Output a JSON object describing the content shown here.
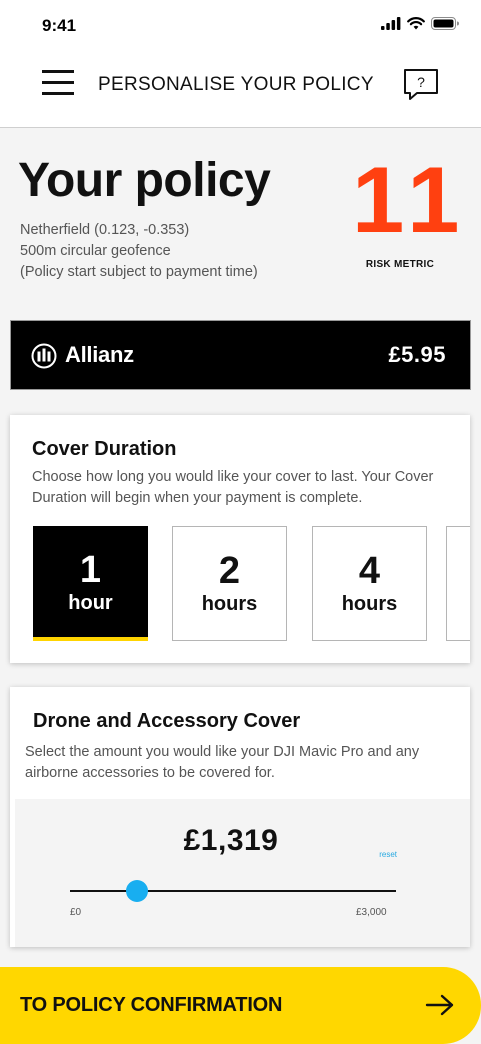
{
  "status_bar": {
    "time": "9:41"
  },
  "header": {
    "title": "PERSONALISE YOUR POLICY"
  },
  "policy": {
    "title": "Your policy",
    "location": "Netherfield (0.123, -0.353)",
    "geofence": "500m circular geofence",
    "start_note": "(Policy start subject to payment time)",
    "risk_value": "11",
    "risk_label": "RISK METRIC"
  },
  "insurer": {
    "name": "Allianz",
    "price": "£5.95"
  },
  "cover_duration": {
    "title": "Cover Duration",
    "description": "Choose how long you would like your cover to last. Your Cover Duration will begin when your payment is complete.",
    "options": [
      {
        "num": "1",
        "unit": "hour"
      },
      {
        "num": "2",
        "unit": "hours"
      },
      {
        "num": "4",
        "unit": "hours"
      }
    ]
  },
  "drone_cover": {
    "title": "Drone and Accessory Cover",
    "description": "Select the amount you would like your DJI Mavic Pro and any airborne accessories to be covered for.",
    "value": "£1,319",
    "reset_label": "reset",
    "min_label": "£0",
    "max_label": "£3,000",
    "slider_fraction": 0.205
  },
  "cta": {
    "label": "TO POLICY CONFIRMATION"
  },
  "colors": {
    "accent_yellow": "#ffd700",
    "risk_orange": "#ff4010",
    "slider_blue": "#18aef0"
  }
}
